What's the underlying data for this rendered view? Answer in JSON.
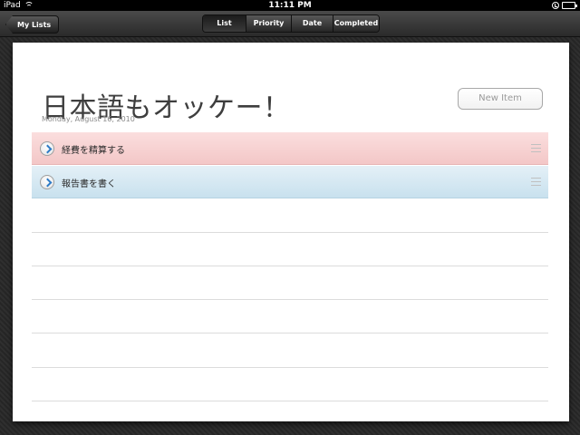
{
  "status": {
    "device": "iPad",
    "time": "11:11 PM"
  },
  "toolbar": {
    "back_label": "My Lists",
    "segments": [
      {
        "label": "List",
        "active": true
      },
      {
        "label": "Priority",
        "active": false
      },
      {
        "label": "Date",
        "active": false
      },
      {
        "label": "Completed",
        "active": false
      }
    ]
  },
  "list": {
    "title": "日本語もオッケー！",
    "date": "Monday, August 16, 2010",
    "new_item_label": "New Item",
    "items": [
      {
        "label": "経費を精算する",
        "color": "#f3c7c7"
      },
      {
        "label": "報告書を書く",
        "color": "#c8e1ee"
      }
    ]
  },
  "colors": {
    "toolbar": "#2a2a2a",
    "paper": "#ffffff",
    "pink_row": "#f3c7c7",
    "blue_row": "#c8e1ee"
  }
}
